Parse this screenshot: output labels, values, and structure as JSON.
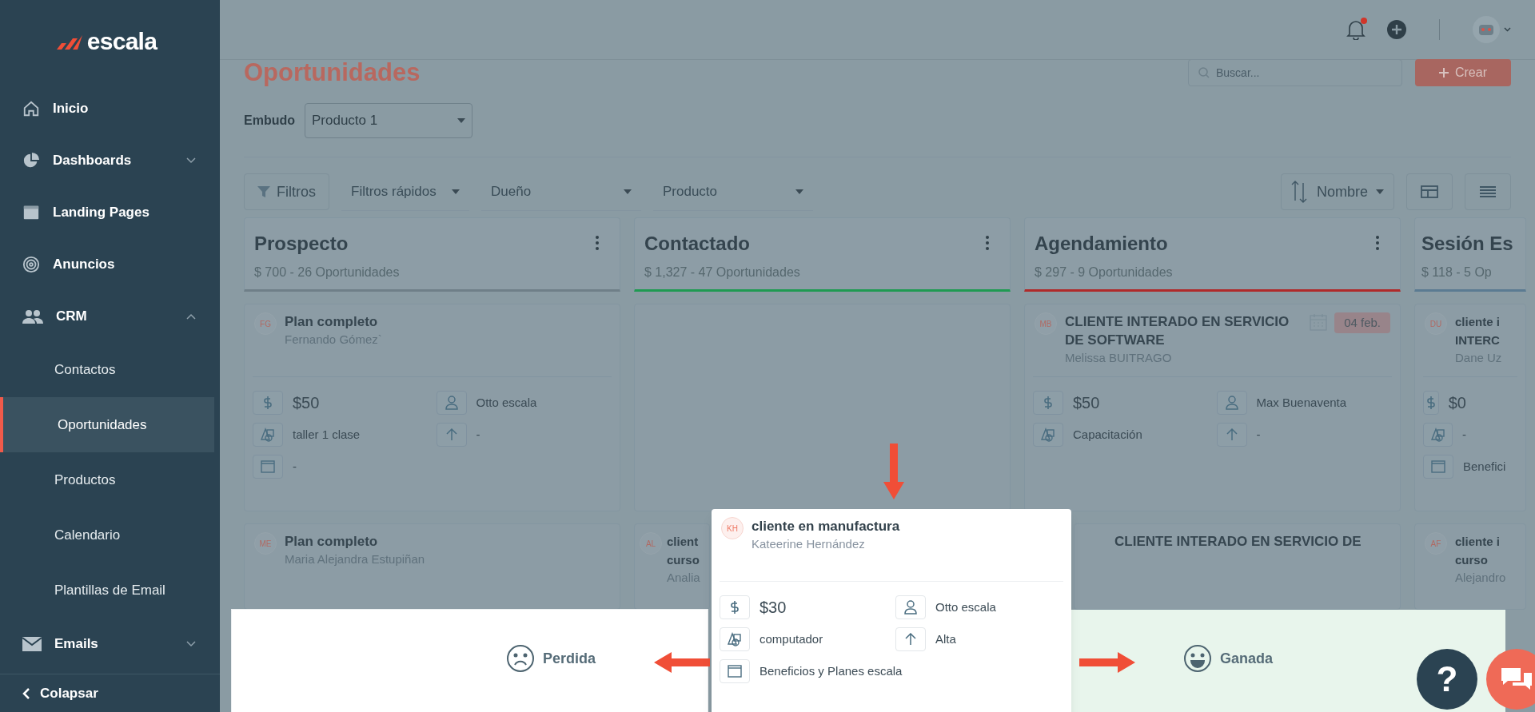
{
  "sidebar": {
    "logo": "escala",
    "items": [
      {
        "label": "Inicio",
        "selected": false
      },
      {
        "label": "Dashboards",
        "selected": false,
        "expanded": false
      },
      {
        "label": "Landing Pages",
        "selected": false
      },
      {
        "label": "Anuncios",
        "selected": false
      },
      {
        "label": "CRM",
        "selected": false,
        "expanded": true,
        "children": [
          {
            "label": "Contactos",
            "selected": false
          },
          {
            "label": "Oportunidades",
            "selected": true
          },
          {
            "label": "Productos",
            "selected": false
          },
          {
            "label": "Calendario",
            "selected": false
          },
          {
            "label": "Plantillas de Email",
            "selected": false
          }
        ]
      },
      {
        "label": "Emails",
        "selected": false,
        "expanded": false
      }
    ],
    "collapse": "Colapsar"
  },
  "header": {
    "notification_dot": true
  },
  "page": {
    "title": "Oportunidades",
    "search": {
      "placeholder": "Buscar..."
    },
    "create_button": "Crear"
  },
  "funnel": {
    "label": "Embudo",
    "value": "Producto 1"
  },
  "filters": [
    {
      "kind": "button",
      "label": "Filtros"
    },
    {
      "kind": "dropdown",
      "label": "Filtros rápidos"
    },
    {
      "kind": "dropdown",
      "label": "Dueño"
    },
    {
      "kind": "dropdown",
      "label": "Producto"
    }
  ],
  "sort": {
    "label": "Nombre"
  },
  "columns": [
    {
      "title": "Prospecto",
      "summary": "$ 700 - 26 Oportunidades",
      "color": "#6f7f88",
      "cards": [
        {
          "initials": "FG",
          "title": "Plan completo",
          "contact": "Fernando Gómez`",
          "amount": "$50",
          "owner": "Otto escala",
          "product": "taller 1 clase",
          "priority": "-",
          "plan": "-"
        },
        {
          "initials": "ME",
          "title": "Plan completo",
          "contact": "Maria Alejandra Estupiñan"
        }
      ]
    },
    {
      "title": "Contactado",
      "summary": "$ 1,327 - 47 Oportunidades",
      "color": "#1f9a52",
      "drop_slot": true,
      "cards": [
        {
          "initials": "AL",
          "title": "client curso",
          "contact": "Analia"
        }
      ]
    },
    {
      "title": "Agendamiento",
      "summary": "$ 297 - 9 Oportunidades",
      "color": "#b02a2a",
      "cards": [
        {
          "initials": "MB",
          "title": "CLIENTE INTERADO EN SERVICIO DE SOFTWARE",
          "contact": "Melissa BUITRAGO",
          "date": "04 feb.",
          "amount": "$50",
          "owner": "Max Buenaventa",
          "product": "Capacitación",
          "priority": "-"
        },
        {
          "title": "CLIENTE INTERADO EN SERVICIO DE"
        }
      ]
    },
    {
      "title": "Sesión Es",
      "summary": "$ 118 - 5 Op",
      "color": "#5b7b92",
      "cards": [
        {
          "initials": "DU",
          "title": "cliente i INTERC",
          "contact": "Dane Uz",
          "amount": "$0",
          "product": "-",
          "plan": "Benefici"
        },
        {
          "initials": "AF",
          "title": "cliente i curso",
          "contact": "Alejandro"
        }
      ]
    }
  ],
  "dragged_card": {
    "initials": "KH",
    "title": "cliente en manufactura",
    "contact": "Kateerine Hernández",
    "amount": "$30",
    "owner": "Otto escala",
    "product": "computador",
    "priority": "Alta",
    "plan": "Beneficios y Planes escala"
  },
  "help_button": "?",
  "drop_zones": [
    {
      "kind": "lost",
      "label": "Perdida"
    },
    {
      "kind": "won",
      "label": "Ganada"
    }
  ]
}
